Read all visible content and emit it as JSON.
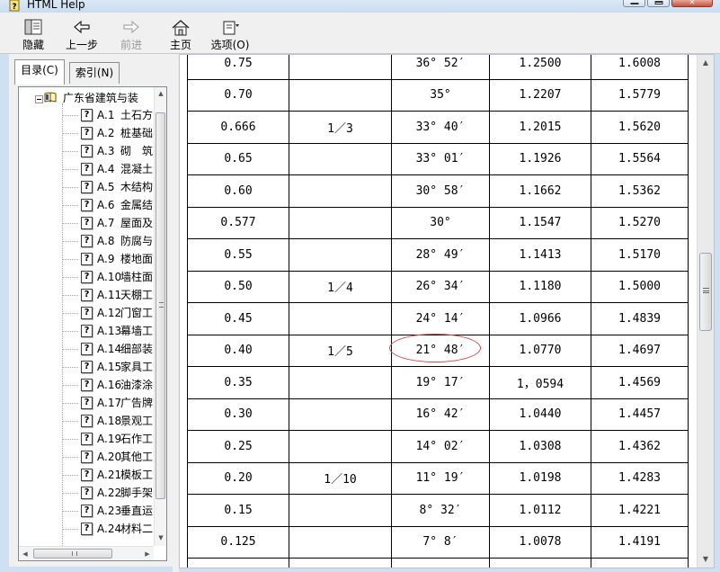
{
  "window": {
    "title": "HTML Help"
  },
  "toolbar": {
    "hide": "隐藏",
    "back": "上一步",
    "forward": "前进",
    "home": "主页",
    "options": "选项(O)"
  },
  "tabs": {
    "contents": "目录(C)",
    "index": "索引(N)"
  },
  "tree": {
    "root_label": "广东省建筑与装",
    "items": [
      {
        "code": "A.1",
        "name": "土石方"
      },
      {
        "code": "A.2",
        "name": "桩基础"
      },
      {
        "code": "A.3",
        "name": "砌　筑"
      },
      {
        "code": "A.4",
        "name": "混凝土"
      },
      {
        "code": "A.5",
        "name": "木结构"
      },
      {
        "code": "A.6",
        "name": "金属结"
      },
      {
        "code": "A.7",
        "name": "屋面及防"
      },
      {
        "code": "A.8",
        "name": "防腐与"
      },
      {
        "code": "A.9",
        "name": "楼地面"
      },
      {
        "code": "A.10",
        "name": "墙柱面"
      },
      {
        "code": "A.11",
        "name": "天棚工"
      },
      {
        "code": "A.12",
        "name": "门窗工"
      },
      {
        "code": "A.13",
        "name": "幕墙工"
      },
      {
        "code": "A.14",
        "name": "细部装"
      },
      {
        "code": "A.15",
        "name": "家具工"
      },
      {
        "code": "A.16",
        "name": "油漆涂"
      },
      {
        "code": "A.17",
        "name": "广告牌"
      },
      {
        "code": "A.18",
        "name": "景观工"
      },
      {
        "code": "A.19",
        "name": "石作工"
      },
      {
        "code": "A.20",
        "name": "其他工"
      },
      {
        "code": "A.21",
        "name": "模板工"
      },
      {
        "code": "A.22",
        "name": "脚手架"
      },
      {
        "code": "A.23",
        "name": "垂直运"
      },
      {
        "code": "A.24",
        "name": "材料二"
      }
    ]
  },
  "table": {
    "rows": [
      [
        "0.75",
        "",
        "36° 52′",
        "1.2500",
        "1.6008"
      ],
      [
        "0.70",
        "",
        "35°",
        "1.2207",
        "1.5779"
      ],
      [
        "0.666",
        "1／3",
        "33° 40′",
        "1.2015",
        "1.5620"
      ],
      [
        "0.65",
        "",
        "33° 01′",
        "1.1926",
        "1.5564"
      ],
      [
        "0.60",
        "",
        "30° 58′",
        "1.1662",
        "1.5362"
      ],
      [
        "0.577",
        "",
        "30°",
        "1.1547",
        "1.5270"
      ],
      [
        "0.55",
        "",
        "28° 49′",
        "1.1413",
        "1.5170"
      ],
      [
        "0.50",
        "1／4",
        "26° 34′",
        "1.1180",
        "1.5000"
      ],
      [
        "0.45",
        "",
        "24° 14′",
        "1.0966",
        "1.4839"
      ],
      [
        "0.40",
        "1／5",
        "21° 48′",
        "1.0770",
        "1.4697"
      ],
      [
        "0.35",
        "",
        "19° 17′",
        "1，0594",
        "1.4569"
      ],
      [
        "0.30",
        "",
        "16° 42′",
        "1.0440",
        "1.4457"
      ],
      [
        "0.25",
        "",
        "14° 02′",
        "1.0308",
        "1.4362"
      ],
      [
        "0.20",
        "1／10",
        "11° 19′",
        "1.0198",
        "1.4283"
      ],
      [
        "0.15",
        "",
        "8° 32′",
        "1.0112",
        "1.4221"
      ],
      [
        "0.125",
        "",
        "7° 8′",
        "1.0078",
        "1.4191"
      ]
    ],
    "highlight_color": "#d64b4b"
  }
}
